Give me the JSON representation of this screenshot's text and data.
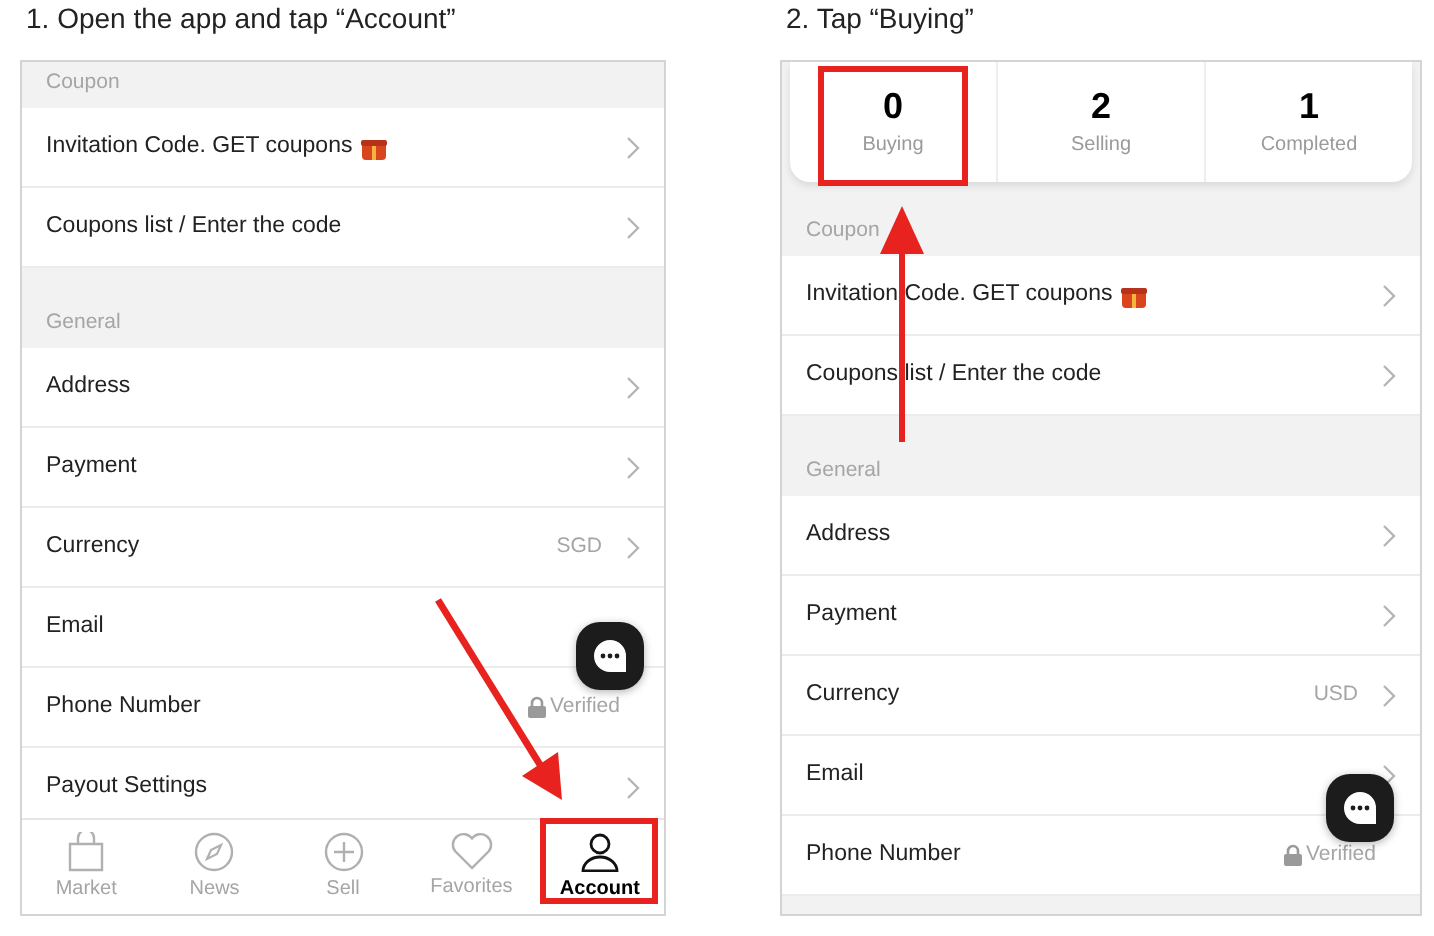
{
  "steps": [
    {
      "caption": "1.  Open the app and tap “Account”",
      "rows": [
        {
          "kind": "header",
          "label": "Coupon"
        },
        {
          "kind": "row",
          "label": "Invitation Code. GET coupons",
          "gift": true,
          "chevron": true
        },
        {
          "kind": "row",
          "label": "Coupons list / Enter the code",
          "chevron": true
        },
        {
          "kind": "header",
          "label": "General"
        },
        {
          "kind": "row",
          "label": "Address",
          "chevron": true
        },
        {
          "kind": "row",
          "label": "Payment",
          "chevron": true
        },
        {
          "kind": "row",
          "label": "Currency",
          "value": "SGD",
          "chevron": true
        },
        {
          "kind": "row",
          "label": "Email",
          "chevron": false
        },
        {
          "kind": "row",
          "label": "Phone Number",
          "value": "Verified",
          "lock": true,
          "chevron": false
        },
        {
          "kind": "row",
          "label": "Payout Settings",
          "chevron": true
        }
      ],
      "tabs": [
        {
          "label": "Market",
          "selected": false,
          "highlighted": false
        },
        {
          "label": "News",
          "selected": false,
          "highlighted": false
        },
        {
          "label": "Sell",
          "selected": false,
          "highlighted": false
        },
        {
          "label": "Favorites",
          "selected": false,
          "highlighted": false
        },
        {
          "label": "Account",
          "selected": true,
          "highlighted": true
        }
      ]
    },
    {
      "caption": "2.  Tap “Buying”",
      "stats": [
        {
          "value": "0",
          "label": "Buying",
          "highlighted": true
        },
        {
          "value": "2",
          "label": "Selling",
          "highlighted": false
        },
        {
          "value": "1",
          "label": "Completed",
          "highlighted": false
        }
      ],
      "rows": [
        {
          "kind": "header",
          "label": "Coupon"
        },
        {
          "kind": "row",
          "label": "Invitation Code. GET coupons",
          "gift": true,
          "chevron": true
        },
        {
          "kind": "row",
          "label": "Coupons list / Enter the code",
          "chevron": true
        },
        {
          "kind": "header",
          "label": "General"
        },
        {
          "kind": "row",
          "label": "Address",
          "chevron": true
        },
        {
          "kind": "row",
          "label": "Payment",
          "chevron": true
        },
        {
          "kind": "row",
          "label": "Currency",
          "value": "USD",
          "chevron": true
        },
        {
          "kind": "row",
          "label": "Email",
          "chevron": true
        },
        {
          "kind": "row",
          "label": "Phone Number",
          "value": "Verified",
          "lock": true,
          "chevron": false
        }
      ]
    }
  ]
}
